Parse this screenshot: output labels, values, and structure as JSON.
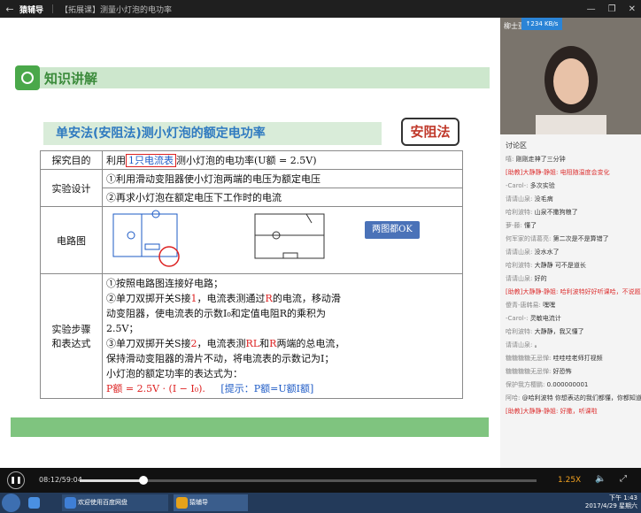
{
  "titlebar": {
    "back": "←",
    "app": "猿辅导",
    "course": "【拓展课】测量小灯泡的电功率"
  },
  "slide": {
    "section_title": "知识讲解",
    "subtitle": "单安法(安阻法)测小灯泡的额定电功率",
    "badge": "安阻法",
    "rows": [
      {
        "label": "探究目的",
        "content_pre": "利用",
        "content_highlight": "1只电流表",
        "content_post": "测小灯泡的电功率(U额 = 2.5V)"
      },
      {
        "label": "实验设计",
        "content": "①利用滑动变阻器使小灯泡两端的电压为额定电压"
      },
      {
        "label": "",
        "content": "②再求小灯泡在额定电压下工作时的电流"
      },
      {
        "label": "电路图",
        "bubble": "两图都OK"
      }
    ],
    "steps_label_1": "实验步骤",
    "steps_label_2": "和表达式",
    "step1": "①按照电路图连接好电路；",
    "step2a": "②单刀双掷开关S接",
    "step2_pos": "1",
    "step2b": "，电流表测通过",
    "step2_r": "R",
    "step2c": "的电流，移动滑",
    "step2d": "动变阻器，使电流表的示数I₀和定值电阻R的乘积为",
    "step2e": "2.5V；",
    "step3a": "③单刀双掷开关S接",
    "step3_pos": "2",
    "step3b": "，电流表测",
    "step3_rl": "RL",
    "step3c": "和",
    "step3_r": "R",
    "step3d": "两端的总电流，",
    "step3e": "保持滑动变阻器的滑片不动，将电流表的示数记为I；",
    "expr_intro": "小灯泡的额定功率的表达式为：",
    "expr": "P额 = 2.5V · (I − I₀).",
    "hint": "[提示：P额=U额I额]"
  },
  "tutor": {
    "name": "柳士亚",
    "speed": "↑234 KB/s"
  },
  "chat": {
    "header": "讨论区",
    "messages": [
      {
        "who": "嘻:",
        "text": "刚刚走神了三分钟",
        "teacher": false
      },
      {
        "who": "[助教]大静静-静姐:",
        "text": "电阻随温度会变化",
        "teacher": true
      },
      {
        "who": "-Carol-:",
        "text": "多次实验",
        "teacher": false
      },
      {
        "who": "请请山泉:",
        "text": "没毛病",
        "teacher": false
      },
      {
        "who": "哈利波特:",
        "text": "山泉不撒狗粮了",
        "teacher": false
      },
      {
        "who": "萝-藤:",
        "text": "懂了",
        "teacher": false
      },
      {
        "who": "何军家的请葛亮:",
        "text": "第二次是不是算错了",
        "teacher": false
      },
      {
        "who": "请请山泉:",
        "text": "没水水了",
        "teacher": false
      },
      {
        "who": "哈利波特:",
        "text": "大静静 可不是道长",
        "teacher": false
      },
      {
        "who": "请请山泉:",
        "text": "好的",
        "teacher": false
      },
      {
        "who": "[助教]大静静-静姐:",
        "text": "哈利波特好好听课哈，不说题的",
        "teacher": true
      },
      {
        "who": "傻青-唐韩易:",
        "text": "嘿嘿",
        "teacher": false
      },
      {
        "who": "-Carol-:",
        "text": "灵敏电流计",
        "teacher": false
      },
      {
        "who": "哈利波特:",
        "text": "大静静，我又懂了",
        "teacher": false
      },
      {
        "who": "请请山泉:",
        "text": "。",
        "teacher": false
      },
      {
        "who": "糖糖糖糖无忌惮:",
        "text": "哇哇哇老师打视频",
        "teacher": false
      },
      {
        "who": "糖糖糖糖无忌惮:",
        "text": "好恐怖",
        "teacher": false
      },
      {
        "who": "保护我方樱鹏:",
        "text": "0.000000001",
        "teacher": false
      },
      {
        "who": "阿哈:",
        "text": "@哈利波特 你想表达的我们都懂，你都知道静姐不是道长，你还欠。",
        "teacher": false
      },
      {
        "who": "[助教]大静静-静姐:",
        "text": "好撒，听课啦",
        "teacher": true
      }
    ]
  },
  "player": {
    "play_icon": "❚❚",
    "time": "08:12/59:04",
    "progress": 0.139,
    "rate": "1.25X",
    "volume_icon": "🔈",
    "fullscreen_icon": "⤢"
  },
  "taskbar": {
    "items": [
      {
        "label": "欢迎使用百度网盘",
        "color": "#3f7fd6"
      },
      {
        "label": "猿辅导",
        "color": "#e6a21a"
      }
    ],
    "time": "下午 1:43",
    "date": "2017/4/29 星期六"
  }
}
